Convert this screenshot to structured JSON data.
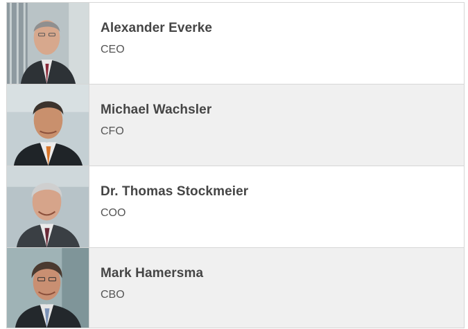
{
  "people": [
    {
      "name": "Alexander Everke",
      "role": "CEO",
      "photo_icon": "portrait-alexander-everke"
    },
    {
      "name": "Michael Wachsler",
      "role": "CFO",
      "photo_icon": "portrait-michael-wachsler"
    },
    {
      "name": "Dr. Thomas Stockmeier",
      "role": "COO",
      "photo_icon": "portrait-thomas-stockmeier"
    },
    {
      "name": "Mark Hamersma",
      "role": "CBO",
      "photo_icon": "portrait-mark-hamersma"
    }
  ],
  "colors": {
    "border": "#d6d6d6",
    "alt_row": "#f0f0f0",
    "name_text": "#454545",
    "role_text": "#555555"
  }
}
